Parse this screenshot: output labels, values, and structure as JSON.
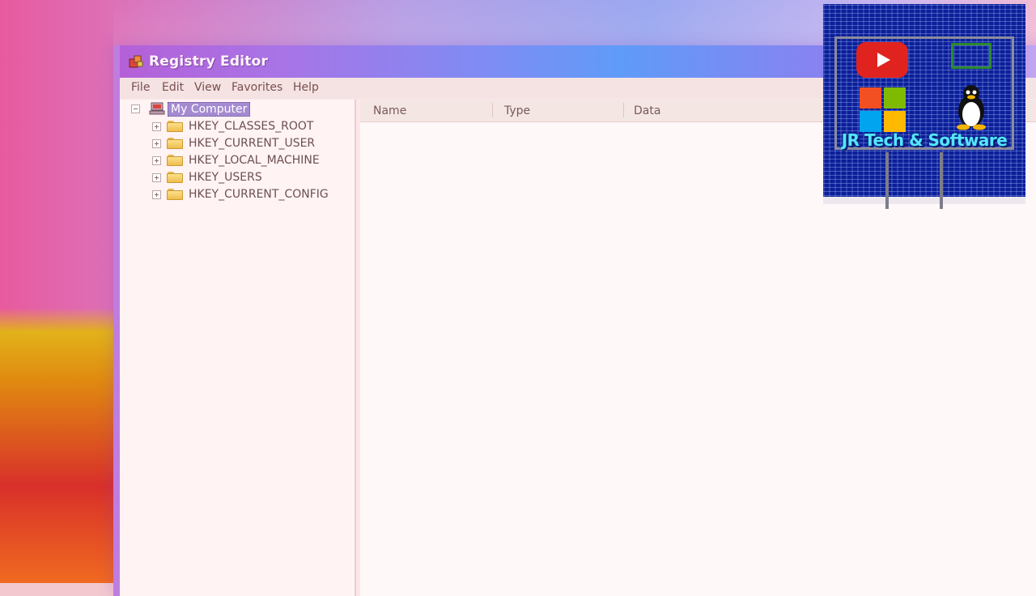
{
  "window": {
    "title": "Registry Editor"
  },
  "menu": [
    {
      "label": "File"
    },
    {
      "label": "Edit"
    },
    {
      "label": "View"
    },
    {
      "label": "Favorites"
    },
    {
      "label": "Help"
    }
  ],
  "tree": {
    "root": {
      "label": "My Computer",
      "icon": "computer-icon",
      "expanded": true,
      "selected": true
    },
    "keys": [
      {
        "label": "HKEY_CLASSES_ROOT",
        "icon": "folder-icon"
      },
      {
        "label": "HKEY_CURRENT_USER",
        "icon": "folder-icon"
      },
      {
        "label": "HKEY_LOCAL_MACHINE",
        "icon": "folder-icon"
      },
      {
        "label": "HKEY_USERS",
        "icon": "folder-icon"
      },
      {
        "label": "HKEY_CURRENT_CONFIG",
        "icon": "folder-icon"
      }
    ]
  },
  "list": {
    "columns": [
      "Name",
      "Type",
      "Data"
    ],
    "rows": []
  },
  "overlay": {
    "channel_name": "JR Tech & Software",
    "icons": [
      "youtube-icon",
      "windows-icon",
      "linux-tux-icon",
      "monitor-icon"
    ]
  },
  "colors": {
    "title_bar_accent": "#5f9bf8",
    "selection": "#a48ad0",
    "folder": "#efbe4d",
    "logo_background": "#0b1f9a",
    "logo_text": "#55e6ff"
  }
}
